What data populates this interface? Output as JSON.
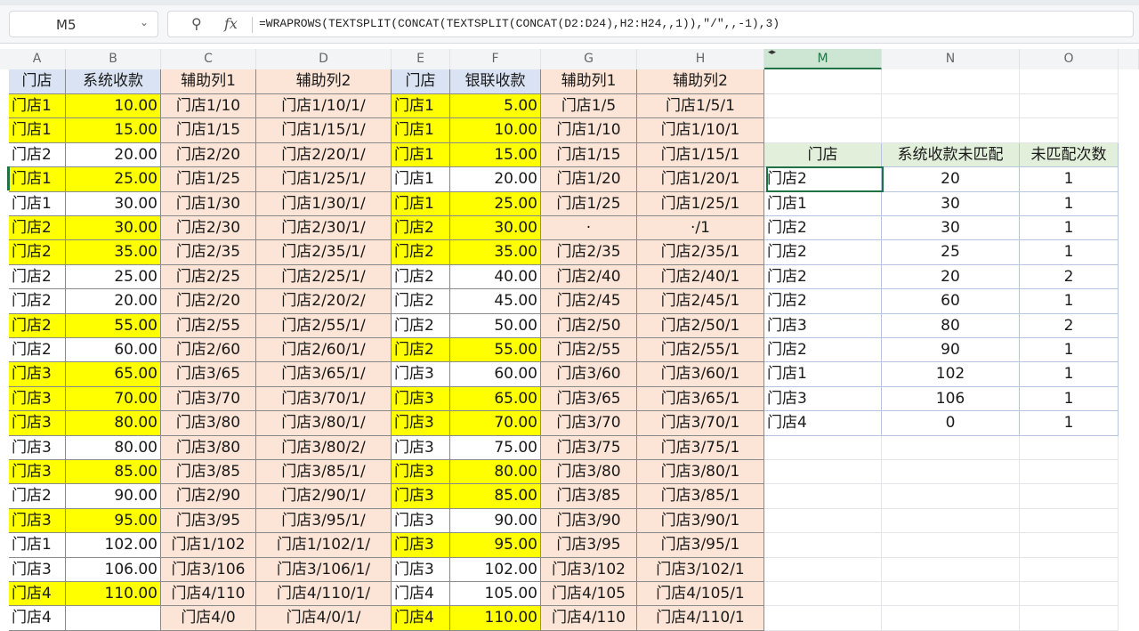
{
  "name_box": "M5",
  "formula": "=WRAPROWS(TEXTSPLIT(CONCAT(TEXTSPLIT(CONCAT(D2:D24),H2:H24,,1)),\"/\",,-1),3)",
  "icons": {
    "name_box_dropdown": "chevron-down-icon",
    "zoom": "zoom-icon",
    "fx": "fx-icon",
    "freeze": "freeze-panes-icon"
  },
  "colors": {
    "yellow": "#ffff00",
    "peach": "#fce4d6",
    "blue_header": "#dae3f3",
    "green_header": "#e2efda",
    "selection": "#217346"
  },
  "columns": [
    "A",
    "B",
    "C",
    "D",
    "E",
    "F",
    "G",
    "H",
    "M",
    "N",
    "O"
  ],
  "table": {
    "headers": [
      "门店",
      "系统收款",
      "辅助列1",
      "辅助列2",
      "门店",
      "银联收款",
      "辅助列1",
      "辅助列2"
    ],
    "rows": [
      {
        "a": "门店1",
        "b": "10.00",
        "c": "门店1/10",
        "d": "门店1/10/1/",
        "e": "门店1",
        "f": "5.00",
        "g": "门店1/5",
        "h": "门店1/5/1",
        "ya": true,
        "ye": true
      },
      {
        "a": "门店1",
        "b": "15.00",
        "c": "门店1/15",
        "d": "门店1/15/1/",
        "e": "门店1",
        "f": "10.00",
        "g": "门店1/10",
        "h": "门店1/10/1",
        "ya": true,
        "ye": true
      },
      {
        "a": "门店2",
        "b": "20.00",
        "c": "门店2/20",
        "d": "门店2/20/1/",
        "e": "门店1",
        "f": "15.00",
        "g": "门店1/15",
        "h": "门店1/15/1",
        "ya": false,
        "ye": true
      },
      {
        "a": "门店1",
        "b": "25.00",
        "c": "门店1/25",
        "d": "门店1/25/1/",
        "e": "门店1",
        "f": "20.00",
        "g": "门店1/20",
        "h": "门店1/20/1",
        "ya": true,
        "ye": false
      },
      {
        "a": "门店1",
        "b": "30.00",
        "c": "门店1/30",
        "d": "门店1/30/1/",
        "e": "门店1",
        "f": "25.00",
        "g": "门店1/25",
        "h": "门店1/25/1",
        "ya": false,
        "ye": true
      },
      {
        "a": "门店2",
        "b": "30.00",
        "c": "门店2/30",
        "d": "门店2/30/1/",
        "e": "门店2",
        "f": "30.00",
        "g": "·",
        "h": "·/1",
        "ya": true,
        "ye": true
      },
      {
        "a": "门店2",
        "b": "35.00",
        "c": "门店2/35",
        "d": "门店2/35/1/",
        "e": "门店2",
        "f": "35.00",
        "g": "门店2/35",
        "h": "门店2/35/1",
        "ya": true,
        "ye": true
      },
      {
        "a": "门店2",
        "b": "25.00",
        "c": "门店2/25",
        "d": "门店2/25/1/",
        "e": "门店2",
        "f": "40.00",
        "g": "门店2/40",
        "h": "门店2/40/1",
        "ya": false,
        "ye": false
      },
      {
        "a": "门店2",
        "b": "20.00",
        "c": "门店2/20",
        "d": "门店2/20/2/",
        "e": "门店2",
        "f": "45.00",
        "g": "门店2/45",
        "h": "门店2/45/1",
        "ya": false,
        "ye": false
      },
      {
        "a": "门店2",
        "b": "55.00",
        "c": "门店2/55",
        "d": "门店2/55/1/",
        "e": "门店2",
        "f": "50.00",
        "g": "门店2/50",
        "h": "门店2/50/1",
        "ya": true,
        "ye": false
      },
      {
        "a": "门店2",
        "b": "60.00",
        "c": "门店2/60",
        "d": "门店2/60/1/",
        "e": "门店2",
        "f": "55.00",
        "g": "门店2/55",
        "h": "门店2/55/1",
        "ya": false,
        "ye": true
      },
      {
        "a": "门店3",
        "b": "65.00",
        "c": "门店3/65",
        "d": "门店3/65/1/",
        "e": "门店3",
        "f": "60.00",
        "g": "门店3/60",
        "h": "门店3/60/1",
        "ya": true,
        "ye": false
      },
      {
        "a": "门店3",
        "b": "70.00",
        "c": "门店3/70",
        "d": "门店3/70/1/",
        "e": "门店3",
        "f": "65.00",
        "g": "门店3/65",
        "h": "门店3/65/1",
        "ya": true,
        "ye": true
      },
      {
        "a": "门店3",
        "b": "80.00",
        "c": "门店3/80",
        "d": "门店3/80/1/",
        "e": "门店3",
        "f": "70.00",
        "g": "门店3/70",
        "h": "门店3/70/1",
        "ya": true,
        "ye": true
      },
      {
        "a": "门店3",
        "b": "80.00",
        "c": "门店3/80",
        "d": "门店3/80/2/",
        "e": "门店3",
        "f": "75.00",
        "g": "门店3/75",
        "h": "门店3/75/1",
        "ya": false,
        "ye": false
      },
      {
        "a": "门店3",
        "b": "85.00",
        "c": "门店3/85",
        "d": "门店3/85/1/",
        "e": "门店3",
        "f": "80.00",
        "g": "门店3/80",
        "h": "门店3/80/1",
        "ya": true,
        "ye": true
      },
      {
        "a": "门店2",
        "b": "90.00",
        "c": "门店2/90",
        "d": "门店2/90/1/",
        "e": "门店3",
        "f": "85.00",
        "g": "门店3/85",
        "h": "门店3/85/1",
        "ya": false,
        "ye": true
      },
      {
        "a": "门店3",
        "b": "95.00",
        "c": "门店3/95",
        "d": "门店3/95/1/",
        "e": "门店3",
        "f": "90.00",
        "g": "门店3/90",
        "h": "门店3/90/1",
        "ya": true,
        "ye": false
      },
      {
        "a": "门店1",
        "b": "102.00",
        "c": "门店1/102",
        "d": "门店1/102/1/",
        "e": "门店3",
        "f": "95.00",
        "g": "门店3/95",
        "h": "门店3/95/1",
        "ya": false,
        "ye": true
      },
      {
        "a": "门店3",
        "b": "106.00",
        "c": "门店3/106",
        "d": "门店3/106/1/",
        "e": "门店3",
        "f": "102.00",
        "g": "门店3/102",
        "h": "门店3/102/1",
        "ya": false,
        "ye": false
      },
      {
        "a": "门店4",
        "b": "110.00",
        "c": "门店4/110",
        "d": "门店4/110/1/",
        "e": "门店4",
        "f": "105.00",
        "g": "门店4/105",
        "h": "门店4/105/1",
        "ya": true,
        "ye": false
      },
      {
        "a": "门店4",
        "b": "",
        "c": "门店4/0",
        "d": "门店4/0/1/",
        "e": "门店4",
        "f": "110.00",
        "g": "门店4/110",
        "h": "门店4/110/1",
        "ya": false,
        "ye": true
      }
    ]
  },
  "result": {
    "headers": [
      "门店",
      "系统收款未匹配",
      "未匹配次数"
    ],
    "rows": [
      [
        "门店2",
        "20",
        "1"
      ],
      [
        "门店1",
        "30",
        "1"
      ],
      [
        "门店2",
        "30",
        "1"
      ],
      [
        "门店2",
        "25",
        "1"
      ],
      [
        "门店2",
        "20",
        "2"
      ],
      [
        "门店2",
        "60",
        "1"
      ],
      [
        "门店3",
        "80",
        "2"
      ],
      [
        "门店2",
        "90",
        "1"
      ],
      [
        "门店1",
        "102",
        "1"
      ],
      [
        "门店3",
        "106",
        "1"
      ],
      [
        "门店4",
        "0",
        "1"
      ]
    ]
  }
}
